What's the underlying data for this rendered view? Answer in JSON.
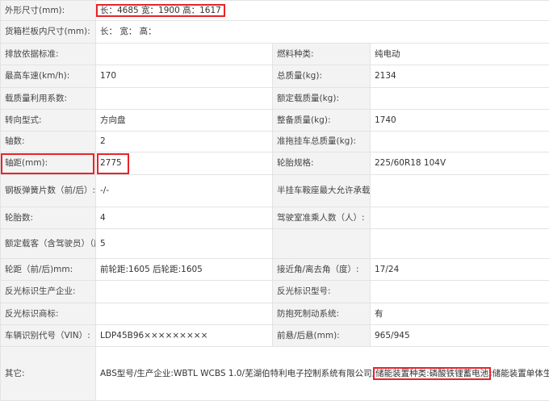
{
  "rows": [
    {
      "l1": "外形尺寸(mm):",
      "full": "长：4685 宽：1900 高：1617"
    },
    {
      "l1": "货箱栏板内尺寸(mm):",
      "full": "长：  宽：  高："
    },
    {
      "l1": "排放依据标准:",
      "v1": "",
      "l2": "燃料种类:",
      "v2": "纯电动"
    },
    {
      "l1": "最高车速(km/h):",
      "v1": "170",
      "l2": "总质量(kg):",
      "v2": "2134"
    },
    {
      "l1": "载质量利用系数:",
      "v1": "",
      "l2": "额定载质量(kg):",
      "v2": ""
    },
    {
      "l1": "转向型式:",
      "v1": "方向盘",
      "l2": "整备质量(kg):",
      "v2": "1740"
    },
    {
      "l1": "轴数:",
      "v1": "2",
      "l2": "准拖挂车总质量(kg):",
      "v2": ""
    },
    {
      "l1": "轴距(mm):",
      "v1": "2775",
      "l2": "轮胎规格:",
      "v2": "225/60R18 104V"
    },
    {
      "l1": "钢板弹簧片数（前/后）:",
      "v1": "-/-",
      "l2": "半挂车鞍座最大允许承载质量(kg):",
      "v2": ""
    },
    {
      "l1": "轮胎数:",
      "v1": "4",
      "l2": "驾驶室准乘人数（人）:",
      "v2": ""
    },
    {
      "l1": "额定载客（含驾驶员）（座位数）:",
      "v1": "5",
      "l2": "",
      "v2": ""
    },
    {
      "l1": "轮距（前/后)mm:",
      "v1": "前轮距:1605 后轮距:1605",
      "l2": "接近角/离去角（度）:",
      "v2": "17/24"
    },
    {
      "l1": "反光标识生产企业:",
      "v1": "",
      "l2": "反光标识型号:",
      "v2": ""
    },
    {
      "l1": "反光标识商标:",
      "v1": "",
      "l2": "防抱死制动系统:",
      "v2": "有"
    },
    {
      "l1": "车辆识别代号（VIN）:",
      "v1": "LDP45B96×××××××××",
      "l2": "前悬/后悬(mm):",
      "v2": "965/945"
    }
  ],
  "other": {
    "label": "其它:",
    "pre": "ABS型号/生产企业:WBTL WCBS 1.0/芜湖伯特利电子控制系统有限公司;",
    "highlight": "储能装置种类:磷酸铁锂蓄电池",
    "post": ";储能装置单体生产企业:中创新航科技集团股份有限公司;储能装置总成生产企业:中创新航科技集团股份有限公司;选装单色车身,无天窗,天窗,行李架,无行李架,防擦条,无轮罩抗流板,无摄像头,轮辋,前组合灯,无前摄像头,内后视镜底座,前部标识,后雨刮,后组合灯,无雷达,无后摄像头,其它说明:驱动电机峰值功率:160KW;该车型可选装ETC车载装置;该车型配备汽车事件数据记录系统(EDR)。"
  },
  "colors": {
    "highlight_border": "#e8232a",
    "label_bg": "#f3f3f3",
    "grid": "#e3e3e3"
  }
}
